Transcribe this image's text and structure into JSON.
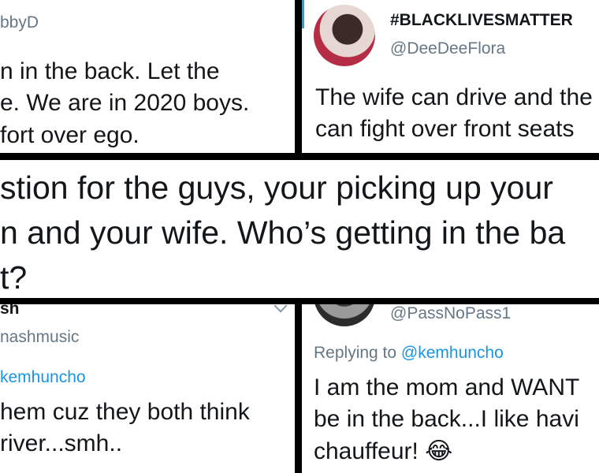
{
  "panel_top_left": {
    "handle_fragment": "bbyD",
    "lines": [
      "n in the back. Let the",
      "e. We are in 2020 boys.",
      "fort over ego."
    ]
  },
  "panel_top_right": {
    "display_name": "#BLACKLIVESMATTER",
    "handle": "@DeeDeeFlora",
    "lines": [
      "The wife can drive and the",
      "can fight over front seats"
    ]
  },
  "panel_middle": {
    "lines": [
      "stion for the guys, your picking up your",
      "n and your wife. Who’s getting in the ba",
      "t?"
    ]
  },
  "panel_bottom_left": {
    "name_fragment": "sh",
    "handle_fragment": "nashmusic",
    "reply_fragment": "kemhuncho",
    "lines": [
      "hem cuz they both think",
      "river...smh.."
    ]
  },
  "panel_bottom_right": {
    "handle": "@PassNoPass1",
    "replying_prefix": "Replying to",
    "replying_handle": "@kemhuncho",
    "lines": [
      "I am the mom and WANT",
      "be in the back...I like havi",
      "chauffeur!"
    ],
    "emoji": "😂"
  },
  "colors": {
    "text": "#14171a",
    "muted": "#657786",
    "link": "#1b95e0",
    "border": "#000000"
  }
}
